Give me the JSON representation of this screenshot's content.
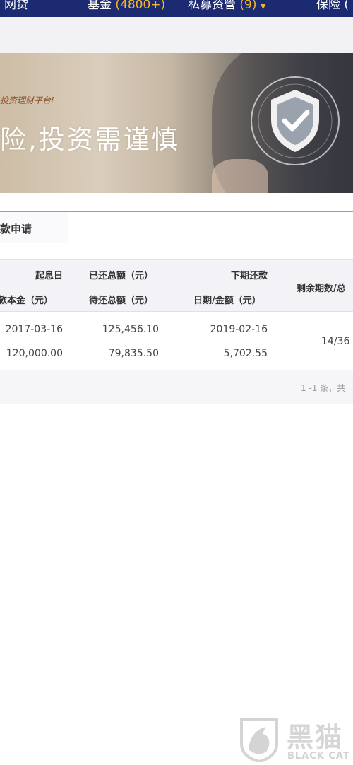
{
  "top_nav": {
    "items": [
      {
        "label": "网贷"
      },
      {
        "label": "基金",
        "count": "(4800+)"
      },
      {
        "label": "私募资管",
        "count": "(9)"
      },
      {
        "label": "保险",
        "count": "("
      }
    ]
  },
  "banner": {
    "subtitle": "投资理财平台!",
    "slogan": "险,投资需谨慎"
  },
  "tab": {
    "active_label": "款申请"
  },
  "table": {
    "headers": {
      "start_date": "起息日",
      "principal": "借款本金（元）",
      "repaid_total": "已还总额（元）",
      "pending_total": "待还总额（元）",
      "next_repay": "下期还款",
      "next_repay_sub": "日期/金额（元）",
      "remaining": "剩余期数/总"
    },
    "rows": [
      {
        "start_date": "2017-03-16",
        "principal": "120,000.00",
        "repaid_total": "125,456.10",
        "pending_total": "79,835.50",
        "next_date": "2019-02-16",
        "next_amount": "5,702.55",
        "remaining": "14/36"
      }
    ]
  },
  "pager": {
    "info": "1 -1 条，共"
  },
  "watermark": {
    "cn": "黑猫",
    "en": "BLACK CAT"
  },
  "colors": {
    "nav_bg": "#1c2a72",
    "nav_accent": "#f6b623",
    "tab_border": "#9a98c4"
  }
}
